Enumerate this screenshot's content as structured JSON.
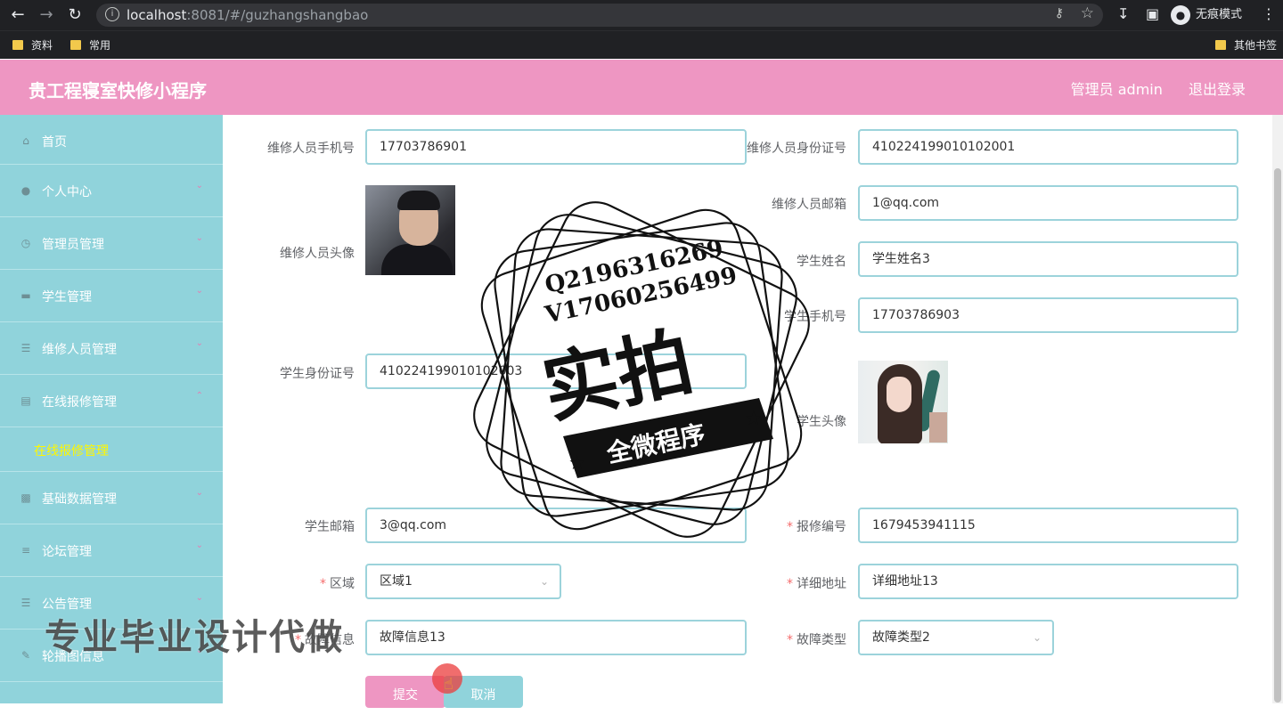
{
  "browser": {
    "url_host": "localhost",
    "url_rest": ":8081/#/guzhangshangbao",
    "incognito_label": "无痕模式",
    "bookmarks": [
      "资料",
      "常用"
    ],
    "other_bookmarks": "其他书签"
  },
  "header": {
    "title": "贵工程寝室快修小程序",
    "user_label": "管理员 admin",
    "logout_label": "退出登录"
  },
  "sidebar": {
    "items": [
      {
        "label": "首页"
      },
      {
        "label": "个人中心"
      },
      {
        "label": "管理员管理"
      },
      {
        "label": "学生管理"
      },
      {
        "label": "维修人员管理"
      },
      {
        "label": "在线报修管理"
      },
      {
        "label": "基础数据管理"
      },
      {
        "label": "论坛管理"
      },
      {
        "label": "公告管理"
      },
      {
        "label": "轮播图信息"
      }
    ],
    "active_sub": "在线报修管理"
  },
  "form": {
    "repair_phone_label": "维修人员手机号",
    "repair_phone": "17703786901",
    "repair_id_label": "维修人员身份证号",
    "repair_id": "410224199010102001",
    "repair_avatar_label": "维修人员头像",
    "repair_email_label": "维修人员邮箱",
    "repair_email": "1@qq.com",
    "student_name_label": "学生姓名",
    "student_name": "学生姓名3",
    "student_phone_label": "学生手机号",
    "student_phone": "17703786903",
    "student_id_label": "学生身份证号",
    "student_id": "410224199010102003",
    "student_avatar_label": "学生头像",
    "student_email_label": "学生邮箱",
    "student_email": "3@qq.com",
    "repair_no_label": "报修编号",
    "repair_no": "1679453941115",
    "region_label": "区域",
    "region": "区域1",
    "address_label": "详细地址",
    "address": "详细地址13",
    "fault_info_label": "故障信息",
    "fault_info": "故障信息13",
    "fault_type_label": "故障类型",
    "fault_type": "故障类型2",
    "submit": "提交",
    "cancel": "取消"
  },
  "watermark": {
    "line1": "Q2196316269",
    "line2": "V17060256499",
    "big": "实拍",
    "banner": "全微程序",
    "bottom": "专业毕业设计代做"
  }
}
